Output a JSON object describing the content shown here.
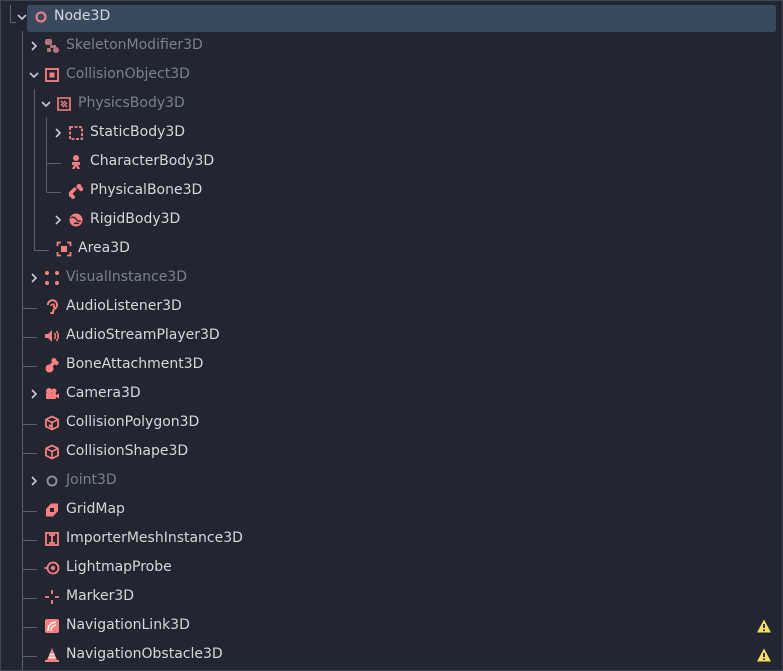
{
  "tree": {
    "accent": "#fc7f7f",
    "items": [
      {
        "label": "Node3D",
        "icon": "node3d-circle-icon"
      },
      {
        "label": "SkeletonModifier3D",
        "icon": "skeleton-modifier-icon"
      },
      {
        "label": "CollisionObject3D",
        "icon": "collision-object-icon"
      },
      {
        "label": "PhysicsBody3D",
        "icon": "physics-body-icon"
      },
      {
        "label": "StaticBody3D",
        "icon": "static-body-icon"
      },
      {
        "label": "CharacterBody3D",
        "icon": "character-body-icon"
      },
      {
        "label": "PhysicalBone3D",
        "icon": "physical-bone-icon"
      },
      {
        "label": "RigidBody3D",
        "icon": "rigid-body-icon"
      },
      {
        "label": "Area3D",
        "icon": "area-icon"
      },
      {
        "label": "VisualInstance3D",
        "icon": "visual-instance-icon"
      },
      {
        "label": "AudioListener3D",
        "icon": "audio-listener-icon"
      },
      {
        "label": "AudioStreamPlayer3D",
        "icon": "audio-stream-player-icon"
      },
      {
        "label": "BoneAttachment3D",
        "icon": "bone-attachment-icon"
      },
      {
        "label": "Camera3D",
        "icon": "camera-icon"
      },
      {
        "label": "CollisionPolygon3D",
        "icon": "collision-polygon-icon"
      },
      {
        "label": "CollisionShape3D",
        "icon": "collision-shape-icon"
      },
      {
        "label": "Joint3D",
        "icon": "joint-icon"
      },
      {
        "label": "GridMap",
        "icon": "gridmap-icon"
      },
      {
        "label": "ImporterMeshInstance3D",
        "icon": "importer-mesh-icon"
      },
      {
        "label": "LightmapProbe",
        "icon": "lightmap-probe-icon"
      },
      {
        "label": "Marker3D",
        "icon": "marker-icon"
      },
      {
        "label": "NavigationLink3D",
        "icon": "navigation-link-icon"
      },
      {
        "label": "NavigationObstacle3D",
        "icon": "navigation-obstacle-icon"
      }
    ]
  }
}
